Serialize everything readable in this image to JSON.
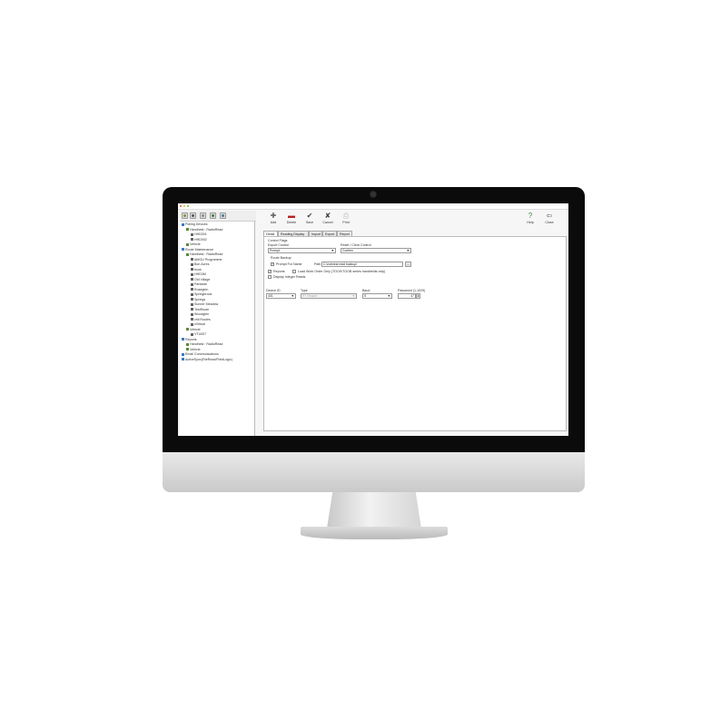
{
  "toolbar": {
    "buttons": [
      {
        "label": "Add",
        "icon": "add-icon"
      },
      {
        "label": "Delete",
        "icon": "delete-icon"
      },
      {
        "label": "Save",
        "icon": "save-icon"
      },
      {
        "label": "Cancel",
        "icon": "cancel-icon"
      },
      {
        "label": "Print",
        "icon": "print-icon"
      }
    ],
    "help": "Help",
    "close": "Close"
  },
  "tree": [
    {
      "label": "Polling Devices",
      "indent": 0
    },
    {
      "label": "Handheld : RadioRead",
      "indent": 1
    },
    {
      "label": "HHD001",
      "indent": 2
    },
    {
      "label": "HHD002",
      "indent": 2
    },
    {
      "label": "Vehicle",
      "indent": 1
    },
    {
      "label": "Route Maintenance",
      "indent": 0
    },
    {
      "label": "Handheld : RadioRead",
      "indent": 1
    },
    {
      "label": "AMGU Programme",
      "indent": 2
    },
    {
      "label": "Bon Acres",
      "indent": 2
    },
    {
      "label": "book",
      "indent": 2
    },
    {
      "label": "HHD3M",
      "indent": 2
    },
    {
      "label": "Old Village",
      "indent": 2
    },
    {
      "label": "Parkside",
      "indent": 2
    },
    {
      "label": "Rosegten",
      "indent": 2
    },
    {
      "label": "Springbrook",
      "indent": 2
    },
    {
      "label": "Springs",
      "indent": 2
    },
    {
      "label": "Sunner Meadow",
      "indent": 2
    },
    {
      "label": "TestRoute",
      "indent": 2
    },
    {
      "label": "Woodglen",
      "indent": 2
    },
    {
      "label": "zhil Routes",
      "indent": 2
    },
    {
      "label": "zVirtual",
      "indent": 2
    },
    {
      "label": "Vehicle",
      "indent": 1
    },
    {
      "label": "VTU007",
      "indent": 2
    },
    {
      "label": "Reports",
      "indent": 0
    },
    {
      "label": "Handheld : RadioRead",
      "indent": 1
    },
    {
      "label": "Vehicle",
      "indent": 1
    },
    {
      "label": "Email Communications",
      "indent": 0
    },
    {
      "label": "ActiveSync(FileRead/FieldLogic)",
      "indent": 0
    }
  ],
  "tabs": [
    "Detail",
    "Reading Display",
    "Import",
    "Export",
    "Report"
  ],
  "form": {
    "control_flags": "Control Flags",
    "export_control_label": "Export Control",
    "export_control_value": "Prompt",
    "reset_clear_label": "Reset / Clear Control",
    "reset_clear_value": "Confirm",
    "route_backup": "Route Backup",
    "prompt_for_name": "Prompt For Name",
    "path_label": "Path",
    "path_value": "C:\\notmeal  read backup\\",
    "browse": "...",
    "reports": "Reports",
    "load_work_orders": "Load Work Order Only (TOOS/TOOB series handhelds only)",
    "display_integer_reads": "Display Integer Reads",
    "device_id_label": "Device ID",
    "device_id_value": "401",
    "type_label": "Type",
    "type_value": "RT Reader",
    "baud_label": "Baud",
    "baud_value": "S",
    "password_label": "Password (1-1029)",
    "password_value": "47"
  }
}
